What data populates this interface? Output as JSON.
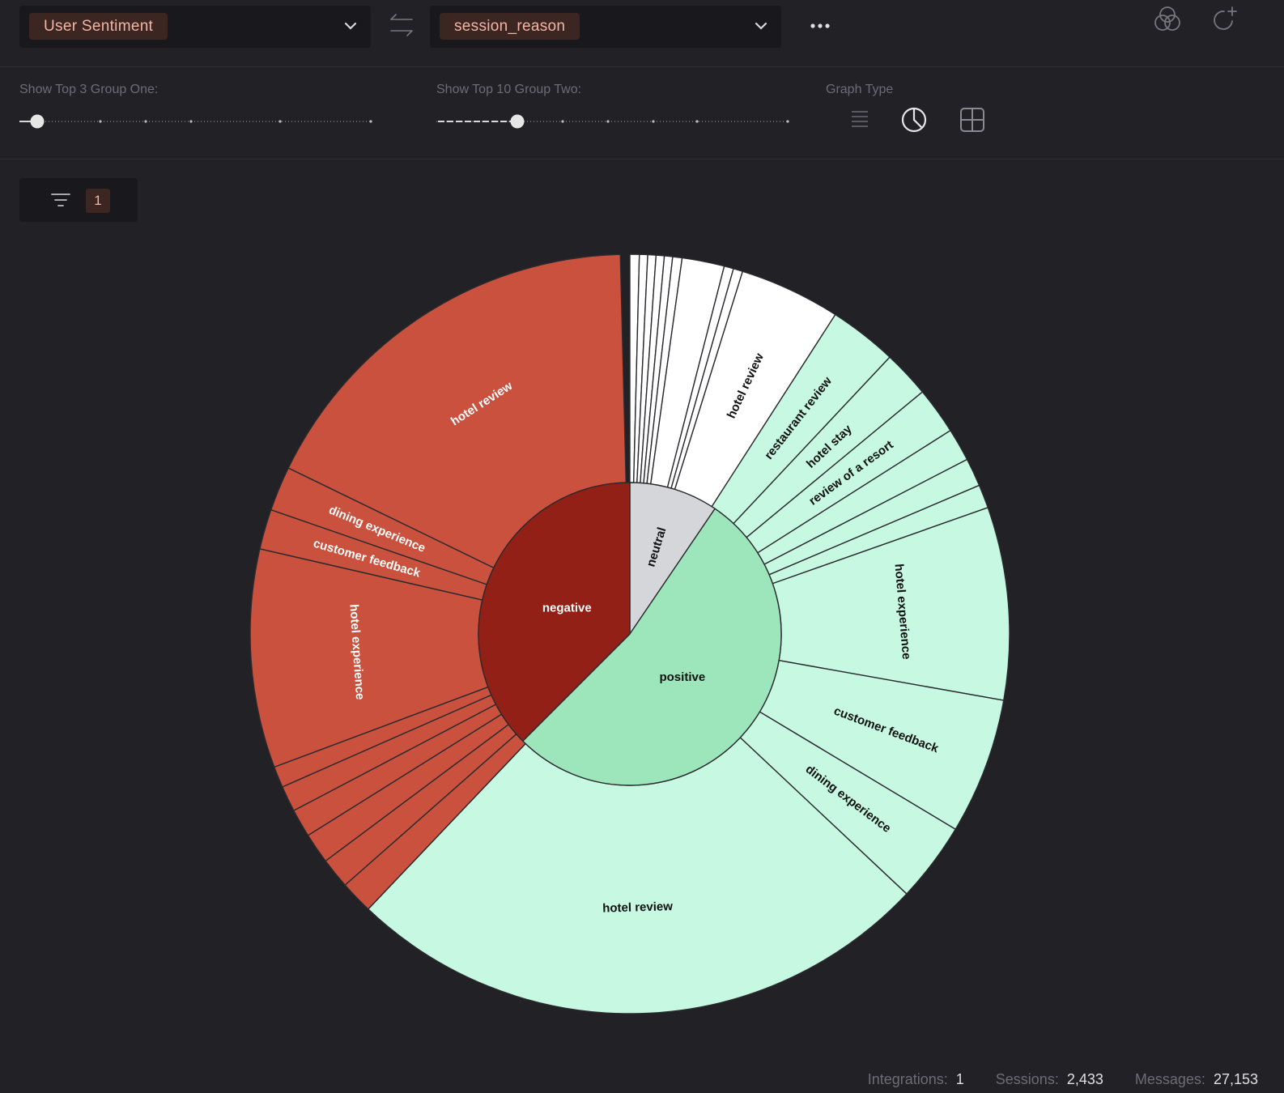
{
  "toolbar": {
    "group_one": "User Sentiment",
    "group_two": "session_reason"
  },
  "controls": {
    "group_one_label": "Show Top 3 Group One:",
    "group_one_value": 3,
    "group_two_label": "Show Top 10 Group Two:",
    "group_two_value": 10,
    "graph_type_label": "Graph Type",
    "graph_type_options": [
      "list-icon",
      "pie-icon",
      "grid-icon"
    ],
    "graph_type_selected": "pie-icon"
  },
  "filter": {
    "count": "1"
  },
  "chart_data": {
    "type": "sunburst",
    "inner": [
      {
        "name": "neutral",
        "value": 9.5,
        "color": "#d4d6da",
        "text": "#111111"
      },
      {
        "name": "positive",
        "value": 53,
        "color": "#9de6bb",
        "text": "#111111"
      },
      {
        "name": "negative",
        "value": 37.5,
        "color": "#932016",
        "text": "#ffffff"
      }
    ],
    "outer": [
      {
        "parent": "neutral",
        "name": "",
        "value": 0.4
      },
      {
        "parent": "neutral",
        "name": "",
        "value": 0.35
      },
      {
        "parent": "neutral",
        "name": "",
        "value": 0.35
      },
      {
        "parent": "neutral",
        "name": "",
        "value": 0.35
      },
      {
        "parent": "neutral",
        "name": "",
        "value": 0.35
      },
      {
        "parent": "neutral",
        "name": "",
        "value": 0.4
      },
      {
        "parent": "neutral",
        "name": "",
        "value": 1.8
      },
      {
        "parent": "neutral",
        "name": "",
        "value": 0.4
      },
      {
        "parent": "neutral",
        "name": "",
        "value": 0.4
      },
      {
        "parent": "neutral",
        "name": "hotel review",
        "value": 4.3
      },
      {
        "parent": "positive",
        "name": "restaurant review",
        "value": 2.9
      },
      {
        "parent": "positive",
        "name": "hotel stay",
        "value": 2.0
      },
      {
        "parent": "positive",
        "name": "review of a resort",
        "value": 2.0
      },
      {
        "parent": "positive",
        "name": "",
        "value": 1.4
      },
      {
        "parent": "positive",
        "name": "",
        "value": 1.2
      },
      {
        "parent": "positive",
        "name": "",
        "value": 1.0
      },
      {
        "parent": "positive",
        "name": "hotel experience",
        "value": 8.2
      },
      {
        "parent": "positive",
        "name": "customer feedback",
        "value": 5.8
      },
      {
        "parent": "positive",
        "name": "dining experience",
        "value": 3.4
      },
      {
        "parent": "positive",
        "name": "hotel review",
        "value": 25.1
      },
      {
        "parent": "negative",
        "name": "",
        "value": 1.4
      },
      {
        "parent": "negative",
        "name": "",
        "value": 1.3
      },
      {
        "parent": "negative",
        "name": "",
        "value": 1.3
      },
      {
        "parent": "negative",
        "name": "",
        "value": 1.2
      },
      {
        "parent": "negative",
        "name": "",
        "value": 1.1
      },
      {
        "parent": "negative",
        "name": "",
        "value": 0.9
      },
      {
        "parent": "negative",
        "name": "hotel experience",
        "value": 9.3
      },
      {
        "parent": "negative",
        "name": "customer feedback",
        "value": 1.7
      },
      {
        "parent": "negative",
        "name": "dining experience",
        "value": 1.9
      },
      {
        "parent": "negative",
        "name": "hotel review",
        "value": 17.4
      }
    ],
    "outer_colors": {
      "neutral": "#ffffff",
      "positive": "#c6f8e2",
      "negative": "#c9513d"
    },
    "outer_text": {
      "neutral": "#111111",
      "positive": "#111111",
      "negative": "#ffffff"
    }
  },
  "footer": {
    "integrations_label": "Integrations:",
    "integrations": "1",
    "sessions_label": "Sessions:",
    "sessions": "2,433",
    "messages_label": "Messages:",
    "messages": "27,153"
  }
}
